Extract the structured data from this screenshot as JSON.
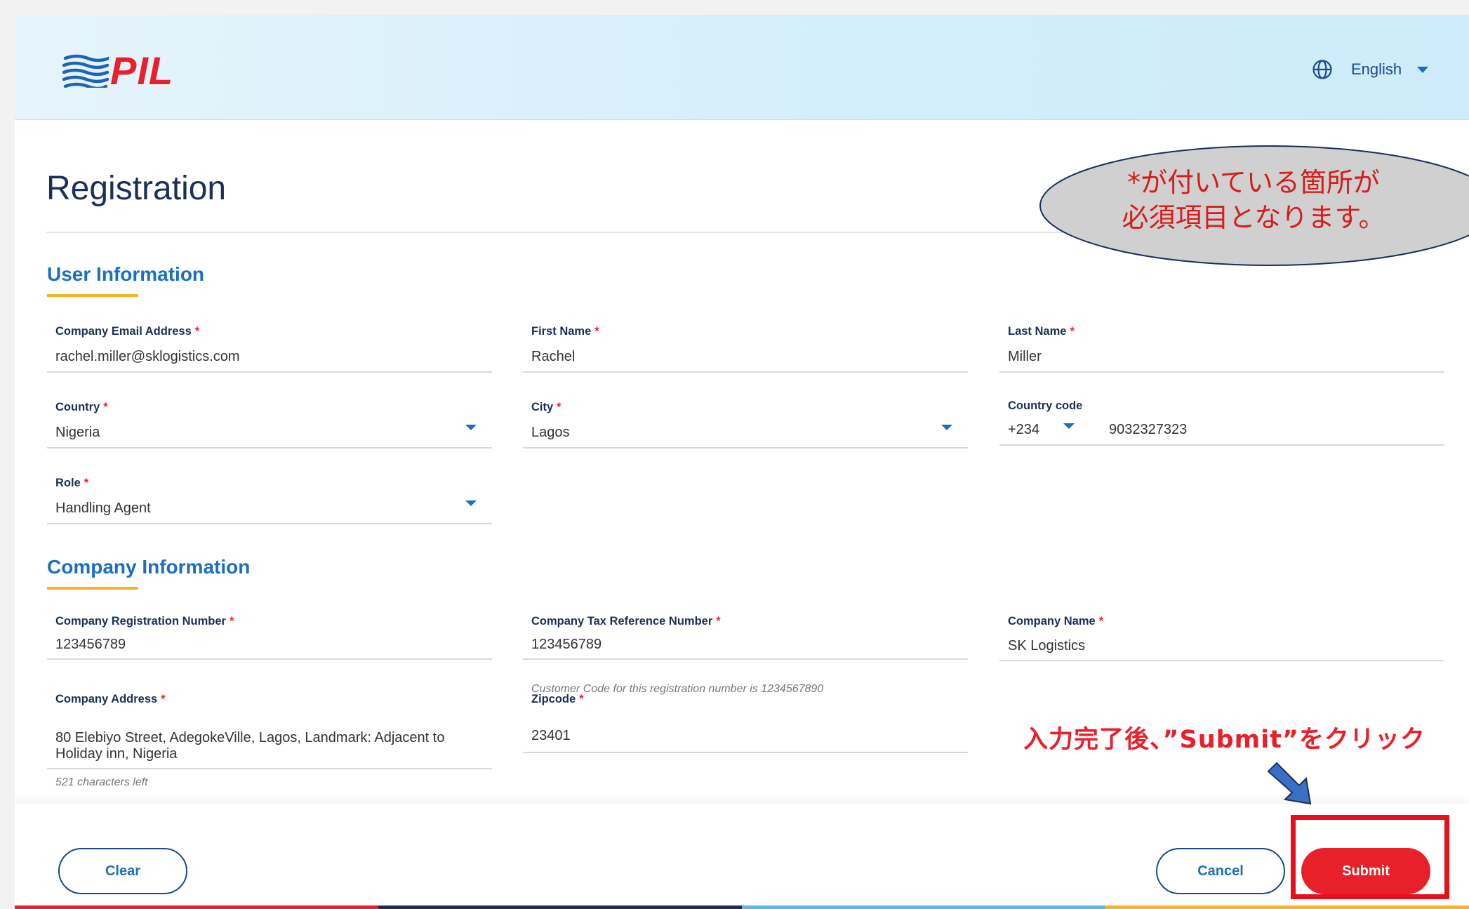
{
  "header": {
    "logo_text": "PIL",
    "language": "English"
  },
  "page_title": "Registration",
  "sections": {
    "user_info": "User Information",
    "company_info": "Company Information"
  },
  "user": {
    "email": {
      "label": "Company Email Address",
      "value": "rachel.miller@sklogistics.com"
    },
    "first_name": {
      "label": "First Name",
      "value": "Rachel"
    },
    "last_name": {
      "label": "Last Name",
      "value": "Miller"
    },
    "country": {
      "label": "Country",
      "value": "Nigeria"
    },
    "city": {
      "label": "City",
      "value": "Lagos"
    },
    "country_code": {
      "label": "Country code",
      "code": "+234",
      "phone": "9032327323"
    },
    "role": {
      "label": "Role",
      "value": "Handling Agent"
    }
  },
  "company": {
    "reg_number": {
      "label": "Company Registration Number",
      "value": "123456789"
    },
    "tax_ref": {
      "label": "Company Tax Reference Number",
      "value": "123456789",
      "helper": "Customer Code for this registration number is  1234567890"
    },
    "name": {
      "label": "Company Name",
      "value": "SK Logistics"
    },
    "address": {
      "label": "Company Address",
      "value": "80 Elebiyo Street,  AdegokeVille, Lagos, Landmark: Adjacent to Holiday inn, Nigeria",
      "helper": "521 characters left"
    },
    "zipcode": {
      "label": "Zipcode",
      "value": "23401"
    }
  },
  "required_mark": "*",
  "buttons": {
    "clear": "Clear",
    "cancel": "Cancel",
    "submit": "Submit"
  },
  "annotations": {
    "bubble_line1": "*が付いている箇所が",
    "bubble_line2": "必須項目となります。",
    "submit_note": "入力完了後、”Submit”をクリック"
  },
  "colors": {
    "brand_red": "#e8202a",
    "brand_blue": "#1a6fc0",
    "navy": "#1b2f5a",
    "accent_yellow": "#f5b427"
  }
}
